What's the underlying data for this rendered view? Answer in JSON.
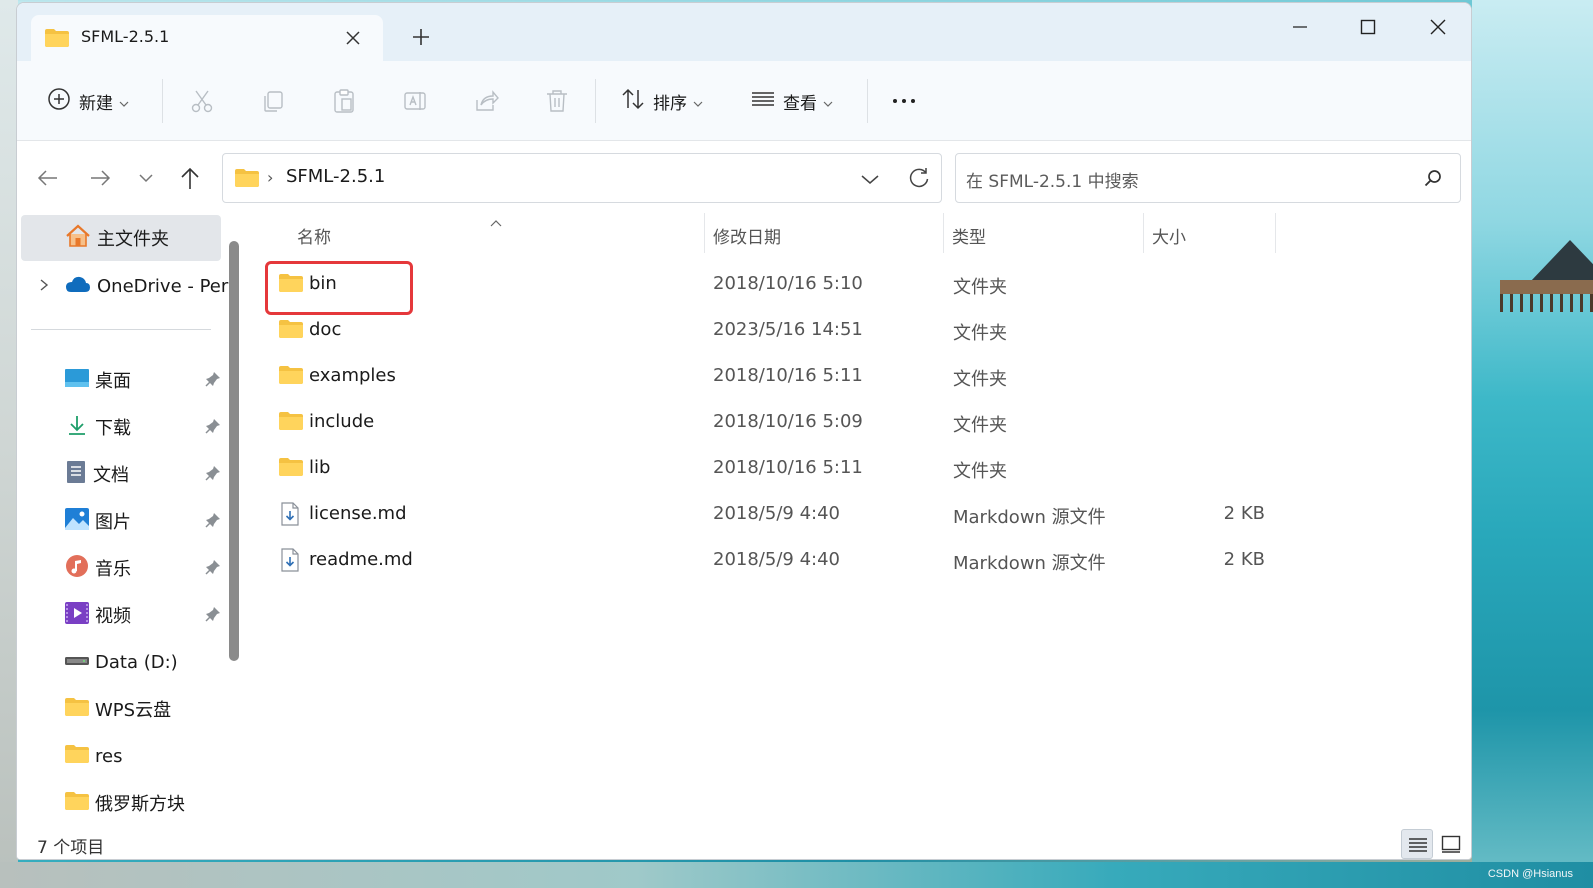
{
  "window": {
    "tab_title": "SFML-2.5.1"
  },
  "toolbar": {
    "new_label": "新建",
    "sort_label": "排序",
    "view_label": "查看"
  },
  "address": {
    "path": "SFML-2.5.1",
    "search_placeholder": "在 SFML-2.5.1 中搜索"
  },
  "sidebar": {
    "home": "主文件夹",
    "onedrive": "OneDrive - Per",
    "items": [
      {
        "label": "桌面",
        "icon": "desktop-icon",
        "pinned": true
      },
      {
        "label": "下载",
        "icon": "download-icon",
        "pinned": true
      },
      {
        "label": "文档",
        "icon": "document-icon",
        "pinned": true
      },
      {
        "label": "图片",
        "icon": "picture-icon",
        "pinned": true
      },
      {
        "label": "音乐",
        "icon": "music-icon",
        "pinned": true
      },
      {
        "label": "视频",
        "icon": "video-icon",
        "pinned": true
      },
      {
        "label": "Data (D:)",
        "icon": "drive-icon",
        "pinned": false
      },
      {
        "label": "WPS云盘",
        "icon": "folder-icon",
        "pinned": false
      },
      {
        "label": "res",
        "icon": "folder-icon",
        "pinned": false
      },
      {
        "label": "俄罗斯方块",
        "icon": "folder-icon",
        "pinned": false
      }
    ]
  },
  "columns": {
    "name": "名称",
    "date": "修改日期",
    "type": "类型",
    "size": "大小"
  },
  "files": [
    {
      "name": "bin",
      "date": "2018/10/16 5:10",
      "type": "文件夹",
      "size": "",
      "icon": "folder-icon"
    },
    {
      "name": "doc",
      "date": "2023/5/16 14:51",
      "type": "文件夹",
      "size": "",
      "icon": "folder-icon"
    },
    {
      "name": "examples",
      "date": "2018/10/16 5:11",
      "type": "文件夹",
      "size": "",
      "icon": "folder-icon"
    },
    {
      "name": "include",
      "date": "2018/10/16 5:09",
      "type": "文件夹",
      "size": "",
      "icon": "folder-icon"
    },
    {
      "name": "lib",
      "date": "2018/10/16 5:11",
      "type": "文件夹",
      "size": "",
      "icon": "folder-icon"
    },
    {
      "name": "license.md",
      "date": "2018/5/9 4:40",
      "type": "Markdown 源文件",
      "size": "2 KB",
      "icon": "markdown-file-icon"
    },
    {
      "name": "readme.md",
      "date": "2018/5/9 4:40",
      "type": "Markdown 源文件",
      "size": "2 KB",
      "icon": "markdown-file-icon"
    }
  ],
  "status": {
    "count": "7 个项目"
  },
  "watermark": "CSDN @Hsianus",
  "colors": {
    "highlight": "#e5383b",
    "folder": "#f5c242",
    "accent": "#0067c0"
  }
}
